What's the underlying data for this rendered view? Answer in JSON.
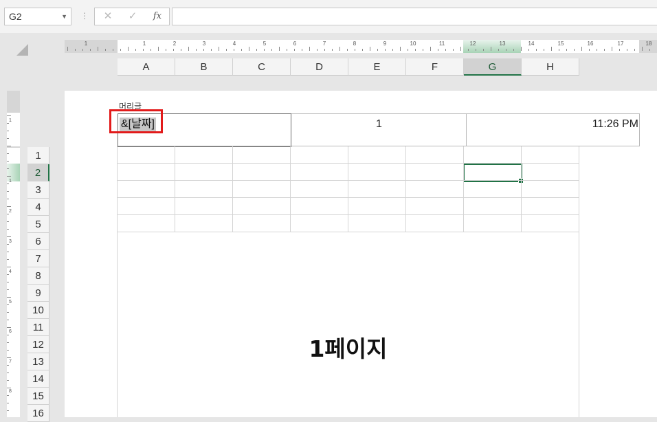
{
  "formula_bar": {
    "name_box": "G2",
    "separator": "⋮",
    "cancel_glyph": "✕",
    "enter_glyph": "✓",
    "fx_label": "fx",
    "formula": ""
  },
  "ruler": {
    "h_labels": [
      "1",
      "1",
      "2",
      "3",
      "4",
      "5",
      "6",
      "7",
      "8",
      "9",
      "10",
      "11",
      "12",
      "13",
      "14",
      "15",
      "16",
      "17",
      "18"
    ],
    "v_labels": [
      "1",
      "1",
      "2",
      "3",
      "4",
      "5",
      "6",
      "7",
      "8"
    ]
  },
  "columns": [
    "A",
    "B",
    "C",
    "D",
    "E",
    "F",
    "G",
    "H"
  ],
  "rows": [
    "1",
    "2",
    "3",
    "4",
    "5",
    "6",
    "7",
    "8",
    "9",
    "10",
    "11",
    "12",
    "13",
    "14",
    "15",
    "16"
  ],
  "selected_cell": "G2",
  "page": {
    "header_caption": "머리글",
    "header_left": "&[날짜]",
    "header_center": "1",
    "header_right": "11:26 PM",
    "watermark": "1페이지"
  },
  "colors": {
    "accent": "#217346",
    "highlight": "#e21a1a"
  }
}
